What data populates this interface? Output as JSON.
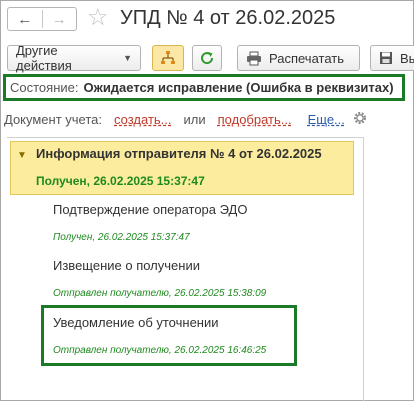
{
  "window": {
    "title": "УПД № 4 от 26.02.2025"
  },
  "toolbar": {
    "other_actions_label": "Другие действия",
    "print_label": "Распечатать",
    "save_label": "Вы"
  },
  "state": {
    "label": "Состояние:",
    "value": "Ожидается исправление (Ошибка в реквизитах)"
  },
  "document_row": {
    "label": "Документ учета:",
    "create_link": "создать...",
    "or_text": "или",
    "pick_link": "подобрать...",
    "more_link": "Еще..."
  },
  "tree": {
    "head": {
      "title": "Информация отправителя № 4 от 26.02.2025",
      "status": "Получен, 26.02.2025 15:37:47"
    },
    "items": [
      {
        "title": "Подтверждение оператора ЭДО",
        "status": "Получен, 26.02.2025 15:37:47"
      },
      {
        "title": "Извещение о получении",
        "status": "Отправлен получателю, 26.02.2025 15:38:09"
      },
      {
        "title": "Уведомление об уточнении",
        "status": "Отправлен получателю, 26.02.2025 16:46:25"
      }
    ]
  },
  "colors": {
    "highlight_border": "#1a7a28",
    "status_green": "#1e8a1e",
    "link_red": "#c0392b",
    "link_blue": "#2a5ba8",
    "selected_row": "#fcec9e"
  },
  "icons": {
    "back": "arrow-left-icon",
    "forward": "arrow-right-icon",
    "favorite": "star-icon",
    "structure": "hierarchy-icon",
    "refresh": "refresh-icon",
    "print": "printer-icon",
    "save": "save-icon",
    "settings": "gear-icon",
    "expand": "triangle-down-icon"
  }
}
